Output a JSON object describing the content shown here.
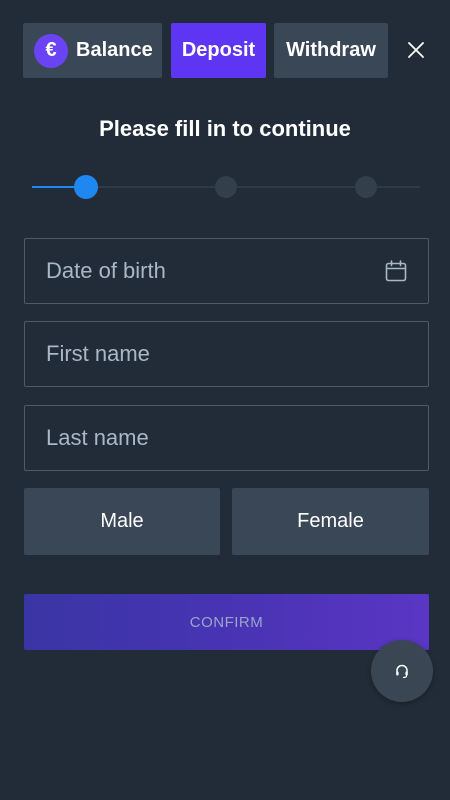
{
  "tabs": {
    "balance": {
      "label": "Balance",
      "currency_symbol": "€"
    },
    "deposit": {
      "label": "Deposit",
      "active": true
    },
    "withdraw": {
      "label": "Withdraw"
    }
  },
  "heading": "Please fill in to continue",
  "stepper": {
    "current_step": 1,
    "total_steps": 3
  },
  "form": {
    "dob": {
      "placeholder": "Date of birth",
      "value": "",
      "icon": "calendar-icon"
    },
    "first_name": {
      "placeholder": "First name",
      "value": ""
    },
    "last_name": {
      "placeholder": "Last name",
      "value": ""
    },
    "gender": {
      "male": "Male",
      "female": "Female"
    },
    "confirm": "CONFIRM"
  },
  "icons": {
    "close": "close-icon",
    "support": "headset-icon"
  },
  "colors": {
    "background": "#222c38",
    "tab": "#3a4756",
    "accent": "#5e35f2",
    "step_active": "#1e88f0",
    "field_border": "#4d5a69"
  }
}
